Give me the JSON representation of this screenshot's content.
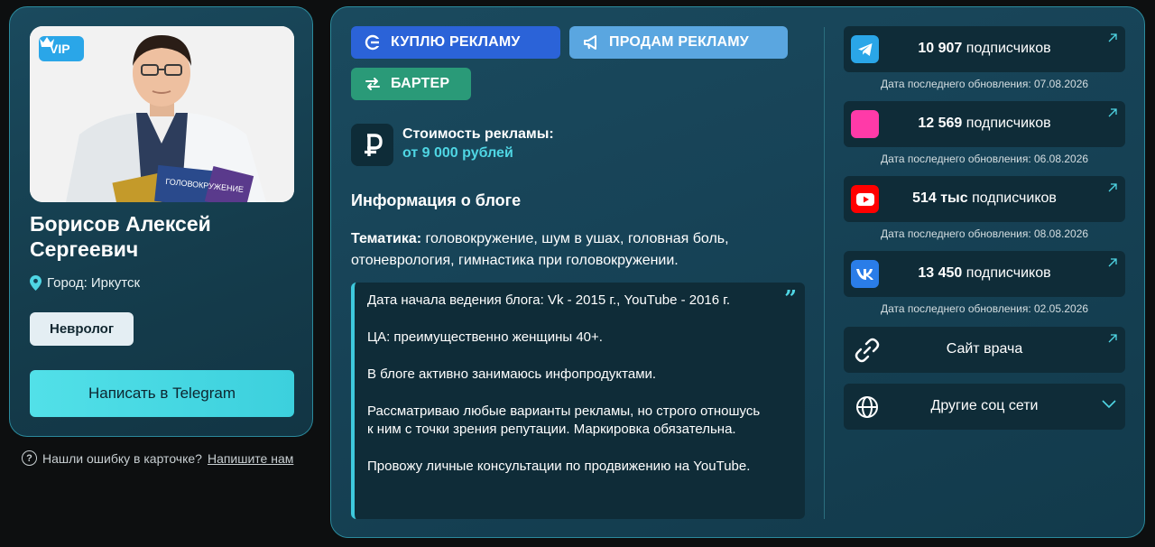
{
  "profile": {
    "vip_label": "VIP",
    "name": "Борисов Алексей Сергеевич",
    "city": "Город: Иркутск",
    "specialty": "Невролог",
    "write_button": "Написать в Telegram",
    "book_title": "ГОЛОВОКРУЖЕНИЕ"
  },
  "report": {
    "question_icon": "?",
    "text": "Нашли ошибку в карточке?",
    "link": "Напишите нам"
  },
  "actions": {
    "buy": "КУПЛЮ РЕКЛАМУ",
    "sell": "ПРОДАМ РЕКЛАМУ",
    "barter": "БАРТЕР"
  },
  "price": {
    "label": "Стоимость рекламы:",
    "value": "от 9 000 рублей"
  },
  "blog": {
    "heading": "Информация о блоге",
    "topics_label": "Тематика:",
    "topics_value": "головокружение, шум в ушах, головная боль, отоневрология, гимнастика при головокружении.",
    "quote_mark": "”",
    "paragraphs": [
      "Дата начала ведения блога: Vk - 2015 г., YouTube - 2016 г.",
      "ЦА: преимущественно женщины 40+.",
      "В блоге активно занимаюсь инфопродуктами.",
      "Рассматриваю любые варианты рекламы, но строго отношусь к ним с точки зрения репутации. Маркировка обязательна.",
      "Провожу личные консультации по продвижению на YouTube."
    ]
  },
  "socials": [
    {
      "network": "telegram",
      "icon": "telegram-icon",
      "color": "#2aa6e8",
      "count": "10 907",
      "suffix": "подписчиков",
      "updated": "Дата последнего обновления: 07.08.2026"
    },
    {
      "network": "instagram",
      "icon": "instagram-icon",
      "color": "#ff3aa8",
      "count": "12 569",
      "suffix": "подписчиков",
      "updated": "Дата последнего обновления: 06.08.2026"
    },
    {
      "network": "youtube",
      "icon": "youtube-icon",
      "color": "#ff0000",
      "count": "514 тыс",
      "suffix": "подписчиков",
      "updated": "Дата последнего обновления: 08.08.2026"
    },
    {
      "network": "vk",
      "icon": "vk-icon",
      "color": "#2a7de8",
      "count": "13 450",
      "suffix": "подписчиков",
      "updated": "Дата последнего обновления: 02.05.2026"
    }
  ],
  "links": {
    "site": "Сайт врача",
    "other": "Другие соц сети"
  },
  "colors": {
    "accent": "#4fd6e4",
    "buy": "#2b63d8",
    "sell": "#5aa6e0",
    "barter": "#2a9a78"
  }
}
